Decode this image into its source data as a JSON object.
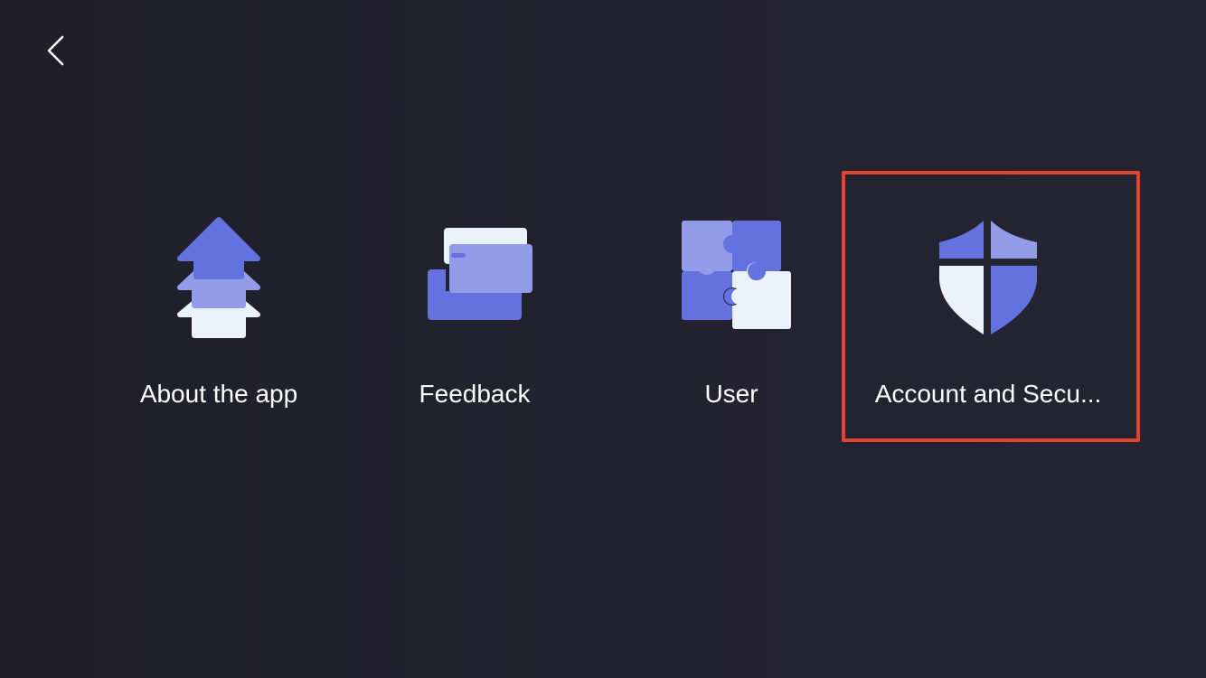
{
  "header": {
    "back_icon": "chevron-left-icon"
  },
  "tiles": [
    {
      "id": "about",
      "label": "About the app",
      "icon": "layered-tree-icon"
    },
    {
      "id": "feedback",
      "label": "Feedback",
      "icon": "inbox-tray-icon"
    },
    {
      "id": "user",
      "label": "User",
      "icon": "puzzle-icon"
    },
    {
      "id": "account",
      "label": "Account and Secu...",
      "icon": "shield-icon"
    }
  ],
  "selected_tile": "account",
  "colors": {
    "background": "#22212e",
    "accent_dark": "#6472e0",
    "accent_mid": "#8c94e6",
    "accent_light": "#eaf2fc",
    "highlight_border": "#e2432c",
    "label_text": "#ffffff"
  }
}
